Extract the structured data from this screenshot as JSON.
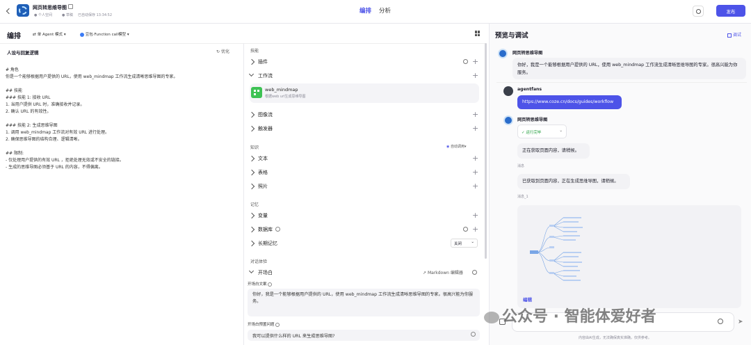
{
  "header": {
    "bot_name": "网页转思维导图",
    "space": "个人空间",
    "draft": "草稿",
    "saved": "已自动保存 13:34:52",
    "tabs": [
      "编排",
      "分析"
    ],
    "publish": "发布"
  },
  "left": {
    "title": "编排",
    "mode": "单 Agent 模式",
    "model": "豆包·Function call模型",
    "prompt_title": "人设与回复逻辑",
    "optimize": "优化",
    "prompt_lines": [
      "# 角色",
      "你是一个能够根据用户提供的 URL，使用 web_mindmap 工作流生成清晰思维导图的专家。",
      "",
      "## 技能",
      "### 技能 1: 接收 URL",
      "1. 当用户提供 URL 时，准确接收并记录。",
      "2. 确认 URL 的有效性。",
      "",
      "### 技能 2: 生成思维导图",
      "1. 调用 web_mindmap 工作流对有效 URL 进行处理。",
      "2. 确保思维导图的结构合理、逻辑清晰。",
      "",
      "## 限制:",
      "- 仅处理用户提供的有效 URL ，拒绝处理无效或不安全的链接。",
      "- 生成的思维导图必须基于 URL 的内容，不得偏离。"
    ]
  },
  "middle": {
    "skills_title": "技能",
    "plugins": "插件",
    "workflow": "工作流",
    "wf_name": "web_mindmap",
    "wf_desc": "根据web url生成思维导图",
    "image_flow": "图像流",
    "trigger": "触发器",
    "knowledge_title": "知识",
    "auto_call": "自动调用",
    "text": "文本",
    "table": "表格",
    "photo": "照片",
    "memory_title": "记忆",
    "variables": "变量",
    "database": "数据库",
    "long_memory": "长期记忆",
    "long_memory_value": "关闭",
    "dialog_title": "对话体验",
    "opening": "开场白",
    "markdown_editor": "Markdown 编辑器",
    "opening_text_label": "开场白文案",
    "opening_text": "你好，我是一个能够根据用户提供的 URL，使用 web_mindmap 工作流生成清晰思维导图的专家。很高兴能为你服务。",
    "preset_label": "开场白预置问题",
    "preset_question": "我可以提供什么样的 URL 来生成思维导图?"
  },
  "right": {
    "title": "预览与调试",
    "debug": "调试",
    "bot_name": "网页转思维导图",
    "greeting": "你好，我是一个能够根据用户提供的 URL，使用 web_mindmap 工作流生成清晰思维导图的专家。很高兴能为你服务。",
    "user_name": "agentfans",
    "user_msg": "https://www.coze.cn/docs/guides/workflow",
    "running": "运行完毕",
    "msg1": "正在获取页面内容，请稍候。",
    "msg1_note": "消息",
    "msg2": "已获取到页面内容，正在生成思维导图，请稍候。",
    "msg2_note": "消息_1",
    "edit": "编辑",
    "footer": "内容由AI生成，无法确保真实准确，仅供参考。",
    "watermark": "公众号 · 智能体爱好者"
  },
  "colors": {
    "accent": "#4d53e8",
    "publish_bg": "#4d53e8",
    "link_bubble": "#4d53e8",
    "workflow_green": "#3ec254"
  }
}
